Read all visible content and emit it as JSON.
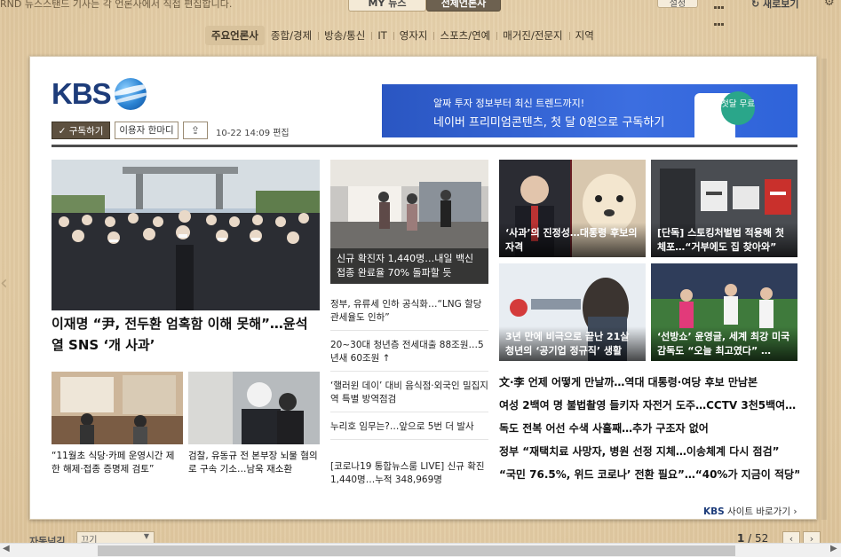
{
  "topbar": {
    "notice": "RND  뉴스스탠드 기사는 각 언론사에서 직접 편집합니다.",
    "tab_my": "MY 뉴스",
    "tab_all": "전체언론사",
    "setting": "설정",
    "refresh": "새로보기"
  },
  "categories": [
    "주요언론사",
    "종합/경제",
    "방송/통신",
    "IT",
    "영자지",
    "스포츠/연예",
    "매거진/전문지",
    "지역"
  ],
  "press": {
    "logo": "KBS",
    "subscribe": "✓ 구독하기",
    "user_comment": "이용자 한마디",
    "edit_time": "10-22 14:09 편집"
  },
  "ad": {
    "line1": "알짜 투자 정보부터 최신 트렌드까지!",
    "line2": "네이버 프리미엄콘텐츠, 첫 달 0원으로 구독하기",
    "badge": "첫달 무료"
  },
  "main_article": {
    "headline": "이재명 “尹, 전두환 엄혹함 이해 못해”…윤석열 SNS ‘개 사과’"
  },
  "small_articles": [
    {
      "caption": "“11월초 식당·카페 운영시간 제한 해제·접종 증명제 검토”"
    },
    {
      "caption": "검찰, 유동규 전 본부장 뇌물 혐의로 구속 기소…남욱 재소환"
    }
  ],
  "photo_mid": {
    "caption": "신규 확진자 1,440명…내일 백신 접종 완료율 70% 돌파할 듯"
  },
  "mid_list": [
    "정부, 유류세 인하 공식화…“LNG 할당관세율도 인하”",
    "20~30대 청년층 전세대출 88조원…5년새 60조원 ↑",
    "‘핼러윈 데이’ 대비 음식점·외국인 밀집지역 특별 방역점검",
    "누리호 임무는?…앞으로 5번 더 발사",
    "[코로나19 통합뉴스룸 LIVE] 신규 확진 1,440명…누적 348,969명"
  ],
  "photo_grid": [
    {
      "caption": "‘사과’의 진정성…대통령 후보의 자격"
    },
    {
      "caption": "[단독] 스토킹처벌법 적용해 첫 체포…“거부에도 집 찾아와”"
    },
    {
      "caption": "3년 만에 비극으로 끝난 21살 청년의 ‘공기업 정규직’ 생활"
    },
    {
      "caption": "‘선방쇼’ 윤영글, 세계 최강 미국 감독도 “오늘 최고였다” …"
    }
  ],
  "right_list": [
    "文·李 언제 어떻게 만날까…역대 대통령·여당 후보 만남본",
    "여성 2백여 명 불법촬영 들키자 자전거 도주…CCTV 3천5백여…",
    "독도 전복 어선 수색 사흘째…추가 구조자 없어",
    "정부 “재택치료 사망자, 병원 선정 지체…이송체계 다시 점검”",
    "“국민 76.5%, 위드 코로나’ 전환 필요”…“40%가 지금이 적당”"
  ],
  "site_link": {
    "brand": "KBS",
    "label": " 사이트 바로가기 ›"
  },
  "bottombar": {
    "auto_label": "자동넘김",
    "auto_value": "끄기",
    "page_current": "1",
    "page_total": " / 52"
  }
}
